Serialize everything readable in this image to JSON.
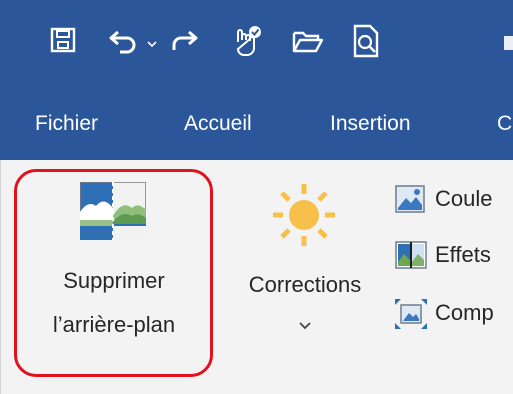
{
  "tabs": {
    "file": "Fichier",
    "home": "Accueil",
    "insert": "Insertion",
    "cut": "C"
  },
  "ribbon": {
    "remove_bg_line1": "Supprimer",
    "remove_bg_line2": "l’arrière-plan",
    "corrections": "Corrections",
    "color": "Coule",
    "effects": "Effets",
    "compress": "Comp"
  },
  "icons": {
    "qat": [
      "save-icon",
      "undo-icon",
      "undo-dropdown-icon",
      "redo-icon",
      "touch-mode-icon",
      "open-folder-icon",
      "print-preview-icon"
    ],
    "remove_background": "remove-background-icon",
    "corrections": "sun-icon",
    "color": "picture-color-icon",
    "effects": "artistic-effects-icon",
    "compress": "compress-pictures-icon"
  },
  "colors": {
    "ribbon_blue": "#2b579a",
    "ribbon_bg": "#f3f3f3",
    "highlight_red": "#e0121e",
    "sun_yellow": "#f7c04a"
  }
}
